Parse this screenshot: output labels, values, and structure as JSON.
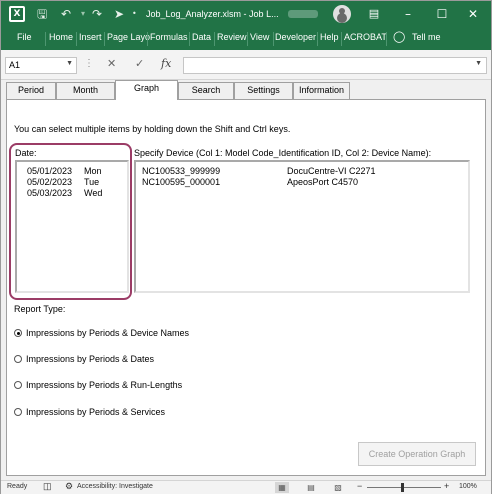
{
  "window": {
    "title": "Job_Log_Analyzer.xlsm  -  Job L...",
    "save_icon": "save-icon",
    "undo_icon": "undo-icon",
    "redo_icon": "redo-icon",
    "app_icon": "excel-icon",
    "app_glyph": "X"
  },
  "ribbon": {
    "tabs": [
      "File",
      "Home",
      "Insert",
      "Page Layo",
      "Formulas",
      "Data",
      "Review",
      "View",
      "Developer",
      "Help",
      "ACROBAT"
    ],
    "tell_me": "Tell me"
  },
  "formula_bar": {
    "name_box": "A1",
    "formula": ""
  },
  "form": {
    "tabs": [
      "Period",
      "Month",
      "Graph",
      "Search",
      "Settings",
      "Information"
    ],
    "active_tab": "Graph",
    "instruction": "You can select multiple items by holding down the Shift and Ctrl keys.",
    "date_label": "Date:",
    "dates": [
      {
        "date": "05/01/2023",
        "dow": "Mon"
      },
      {
        "date": "05/02/2023",
        "dow": "Tue"
      },
      {
        "date": "05/03/2023",
        "dow": "Wed"
      }
    ],
    "device_label": "Specify Device (Col 1: Model Code_Identification ID, Col 2: Device Name):",
    "devices": [
      {
        "id": "NC100533_999999",
        "name": "DocuCentre-VI C2271"
      },
      {
        "id": "NC100595_000001",
        "name": "ApeosPort C4570"
      }
    ],
    "report_type_label": "Report Type:",
    "report_types": [
      {
        "label": "Impressions by Periods & Device Names",
        "selected": true
      },
      {
        "label": "Impressions by Periods & Dates",
        "selected": false
      },
      {
        "label": "Impressions by Periods & Run-Lengths",
        "selected": false
      },
      {
        "label": "Impressions by Periods & Services",
        "selected": false
      }
    ],
    "create_button": "Create Operation Graph"
  },
  "status_bar": {
    "ready": "Ready",
    "accessibility": "Accessibility: Investigate",
    "zoom": "100%",
    "zoom_minus": "−",
    "zoom_plus": "+"
  },
  "colors": {
    "ribbon": "#217346",
    "highlight": "#9b3c66"
  }
}
